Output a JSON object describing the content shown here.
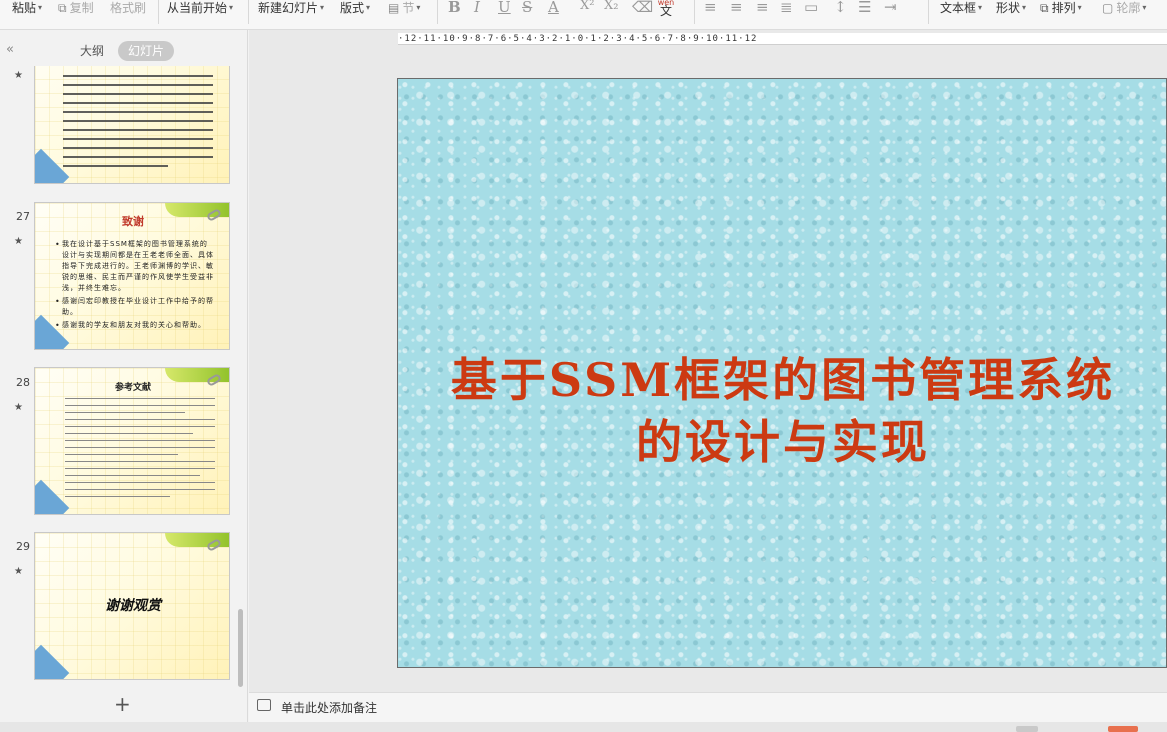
{
  "toolbar": {
    "paste": "粘贴",
    "copy": "复制",
    "format_painter": "格式刷",
    "from_current": "从当前开始",
    "new_slide": "新建幻灯片",
    "layout": "版式",
    "section": "节",
    "textbox": "文本框",
    "shape": "形状",
    "arrange": "排列",
    "outline": "轮廓",
    "wen_label": "wen",
    "wen_char": "文"
  },
  "panel": {
    "tab_outline": "大纲",
    "tab_slides": "幻灯片",
    "add_slide": "+"
  },
  "thumbnails": [
    {
      "number": "",
      "star": "★"
    },
    {
      "number": "27",
      "star": "★",
      "title": "致谢",
      "bullets": [
        "我在设计基于SSM框架的图书管理系统的设计与实现期间都是在王老老师全面、具体指导下完成进行的。王老师渊博的学识、敏锐的思维、民主而严谨的作风使学生受益非浅，并终生难忘。",
        "感谢闫宏印教授在毕业设计工作中给予的帮助。",
        "感谢我的学友和朋友对我的关心和帮助。"
      ]
    },
    {
      "number": "28",
      "star": "★",
      "title": "参考文献"
    },
    {
      "number": "29",
      "star": "★",
      "title": "谢谢观赏"
    }
  ],
  "ruler": "·12·11·10·9·8·7·6·5·4·3·2·1·0·1·2·3·4·5·6·7·8·9·10·11·12",
  "slide": {
    "title_line1": "基于SSM框架的图书管理系统",
    "title_line2": "的设计与实现"
  },
  "notes": {
    "placeholder": "单击此处添加备注"
  },
  "colors": {
    "title_red": "#cc3a12",
    "slide_bg": "#a6dde6",
    "status_accent": "#e8704e"
  }
}
